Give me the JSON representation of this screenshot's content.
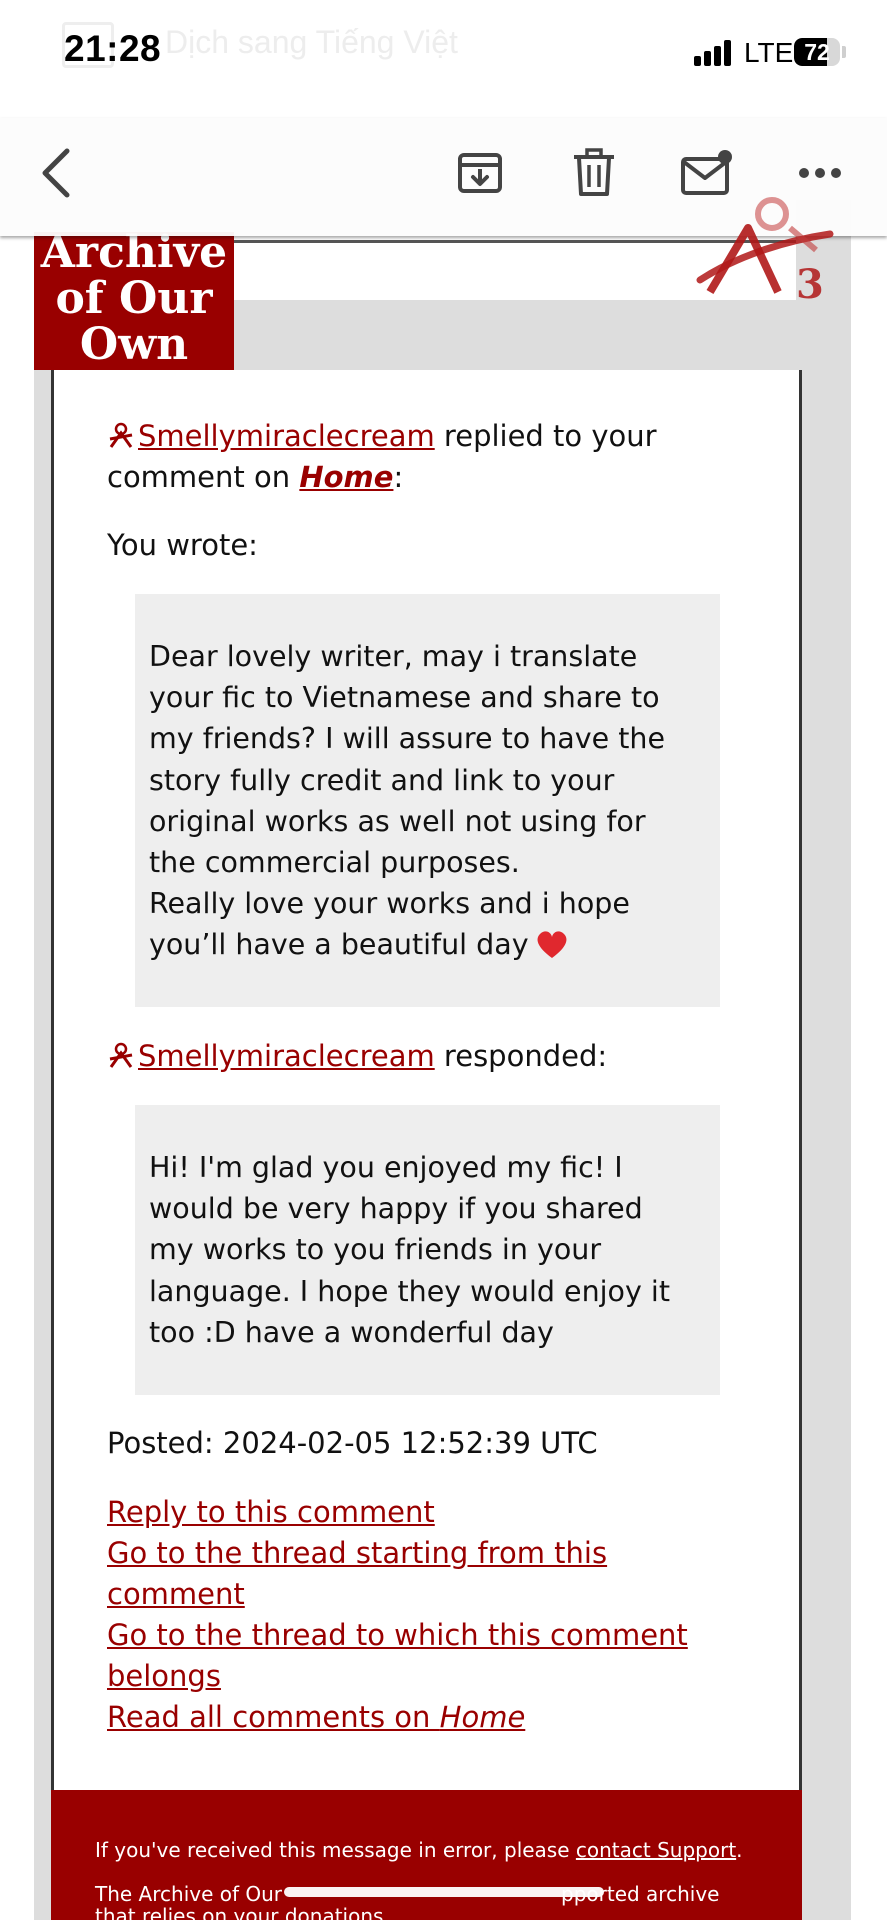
{
  "status_bar": {
    "time": "21:28",
    "network": "LTE",
    "battery": "72",
    "battery_level": 0.72,
    "background_title": "Dịch sang Tiếng Việt"
  },
  "toolbar": {
    "back_icon": "chevron-left-icon",
    "archive_icon": "archive-tray-icon",
    "delete_icon": "trash-icon",
    "unread_icon": "mail-unread-icon",
    "more_icon": "ellipsis-icon"
  },
  "brand": {
    "name_line1": "Archive",
    "name_line2": "of Our",
    "name_line3": "Own",
    "accent_color": "#990000"
  },
  "email": {
    "reply_user": "Smellymiraclecream",
    "reply_text_1": " replied to your",
    "reply_text_2": "comment on ",
    "work_title": "Home",
    "colon": ":",
    "you_wrote": "You wrote:",
    "original_comment_lines": [
      "Dear lovely writer, may i translate",
      "your fic to Vietnamese and share to",
      "my friends? I will assure to have the",
      "story fully credit and link to your",
      "original works as well not using for",
      "the commercial purposes.",
      "Really love your works and i hope",
      "you’ll have a beautiful day"
    ],
    "responder": "Smellymiraclecream",
    "responded": " responded:",
    "response_lines": [
      "Hi! I'm glad you enjoyed my fic! I",
      "would be very happy if you shared",
      "my works to you friends in your",
      "language. I hope they would enjoy it",
      "too :D have a wonderful day"
    ],
    "posted": "Posted: 2024-02-05 12:52:39 UTC",
    "links": {
      "reply": "Reply to this comment",
      "thread_start_1": "Go to the thread starting from this",
      "thread_start_2": "comment",
      "thread_belongs_1": "Go to the thread to which this comment",
      "thread_belongs_2": "belongs",
      "read_all": "Read all comments on ",
      "read_all_work": "Home"
    }
  },
  "footer": {
    "error_text": "If you've received this message in error, please ",
    "support_link": "contact Support",
    "period": ".",
    "archive_text_1": "The Archive of Our",
    "archive_text_2": "pported archive",
    "archive_text_3": "that relies on your donations."
  }
}
